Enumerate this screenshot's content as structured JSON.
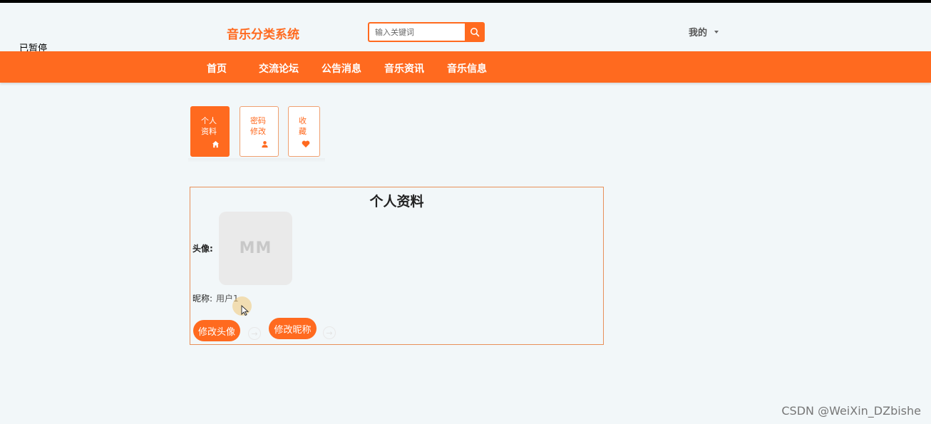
{
  "overlay": {
    "paused_text": "已暂停"
  },
  "header": {
    "site_title": "音乐分类系统",
    "search": {
      "placeholder": "输入关键词",
      "value": ""
    },
    "user_menu_label": "我的"
  },
  "nav": {
    "items": [
      {
        "label": "首页"
      },
      {
        "label": "交流论坛"
      },
      {
        "label": "公告消息"
      },
      {
        "label": "音乐资讯"
      },
      {
        "label": "音乐信息"
      }
    ]
  },
  "side_tabs": [
    {
      "label": "个人\n资料",
      "icon": "home-icon",
      "active": true
    },
    {
      "label": "密码\n修改",
      "icon": "user-icon",
      "active": false
    },
    {
      "label": "收\n藏",
      "icon": "heart-icon",
      "active": false
    }
  ],
  "profile": {
    "title": "个人资料",
    "avatar_label": "头像:",
    "avatar_initials": "MM",
    "nickname_label": "昵称:",
    "nickname_value": "用户1",
    "change_avatar_button": "修改头像",
    "change_nickname_button": "修改昵称"
  },
  "watermark": "CSDN @WeiXin_DZbishe",
  "colors": {
    "accent": "#ff6a1f",
    "background": "#f2f7f9"
  }
}
